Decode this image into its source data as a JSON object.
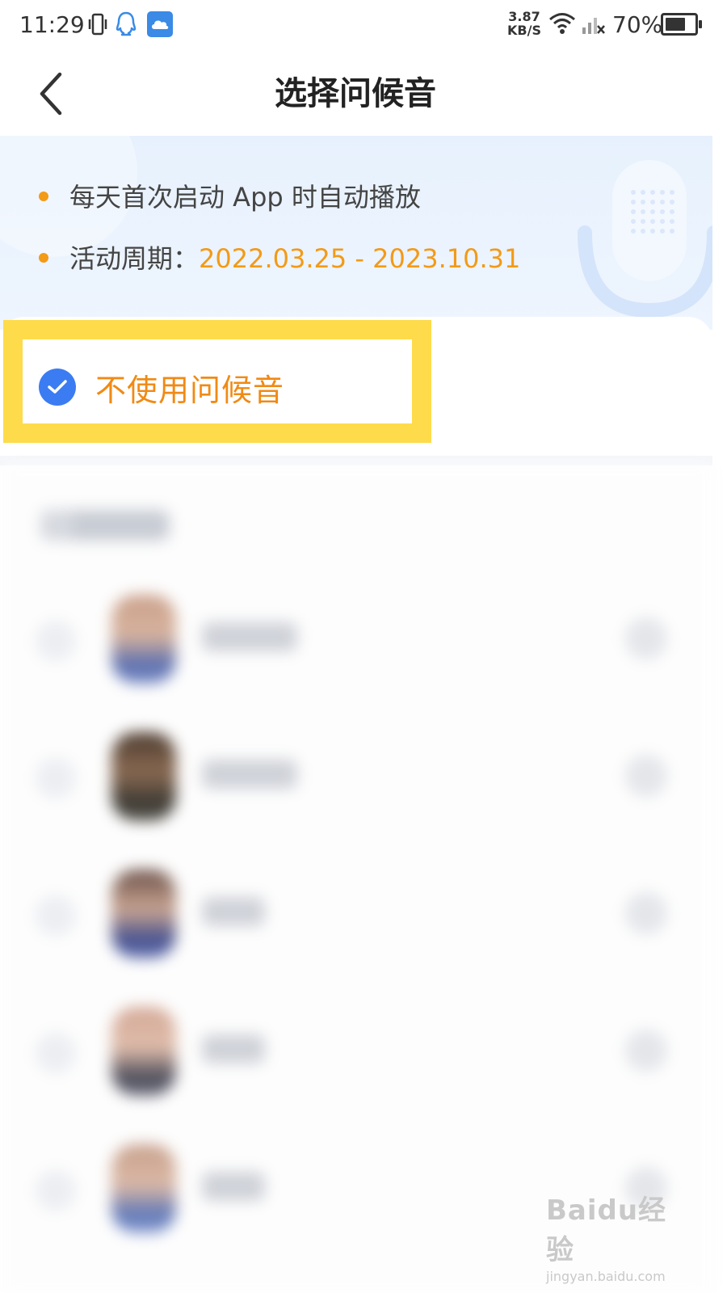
{
  "status_bar": {
    "time": "11:29",
    "net_speed_value": "3.87",
    "net_speed_unit": "KB/S",
    "battery_text": "70%",
    "battery_level": 0.7
  },
  "nav": {
    "title": "选择问候音"
  },
  "banner": {
    "bullet1": "每天首次启动 App 时自动播放",
    "bullet2_label": "活动周期：",
    "bullet2_date": "2022.03.25 - 2023.10.31",
    "accent_color": "#f39a17"
  },
  "option": {
    "label": "不使用问候音",
    "selected": true,
    "check_color": "#3c7cf2",
    "label_color": "#f08a14",
    "highlight_color": "#fedb4a"
  },
  "watermark": {
    "logo": "Baidu经验",
    "url": "jingyan.baidu.com"
  }
}
